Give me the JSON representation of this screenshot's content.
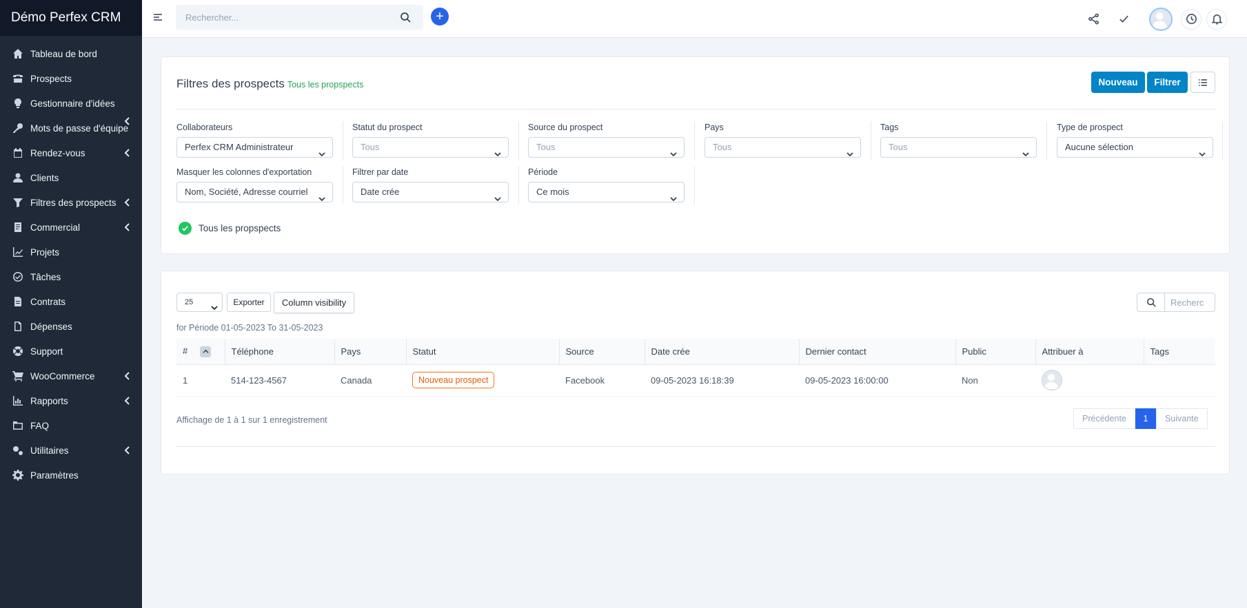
{
  "brand": "Démo Perfex CRM",
  "sidebar": {
    "items": [
      {
        "label": "Tableau de bord",
        "icon": "home-icon"
      },
      {
        "label": "Prospects",
        "icon": "tty-icon"
      },
      {
        "label": "Gestionnaire d'idées",
        "icon": "lightbulb-icon"
      },
      {
        "label": "Mots de passe d'équipe",
        "icon": "key-icon"
      },
      {
        "label": "Rendez-vous",
        "icon": "calendar-icon"
      },
      {
        "label": "Clients",
        "icon": "user-icon"
      },
      {
        "label": "Filtres des prospects",
        "icon": "filter-icon"
      },
      {
        "label": "Commercial",
        "icon": "receipt-icon"
      },
      {
        "label": "Projets",
        "icon": "chart-icon"
      },
      {
        "label": "Tâches",
        "icon": "check-circle-icon"
      },
      {
        "label": "Contrats",
        "icon": "contract-icon"
      },
      {
        "label": "Dépenses",
        "icon": "expense-icon"
      },
      {
        "label": "Support",
        "icon": "lifebuoy-icon"
      },
      {
        "label": "WooCommerce",
        "icon": "cart-icon"
      },
      {
        "label": "Rapports",
        "icon": "bar-chart-icon"
      },
      {
        "label": "FAQ",
        "icon": "folder-icon"
      },
      {
        "label": "Utilitaires",
        "icon": "cogs-icon"
      },
      {
        "label": "Paramètres",
        "icon": "gear-icon"
      }
    ]
  },
  "header": {
    "search_placeholder": "Rechercher..."
  },
  "filters_panel": {
    "title": "Filtres des prospects",
    "subtitle": "Tous les propspects",
    "new_button": "Nouveau",
    "filter_button": "Filtrer",
    "fields": [
      {
        "label": "Collaborateurs",
        "value": "Perfex CRM Administrateur"
      },
      {
        "label": "Statut du prospect",
        "value": "Tous"
      },
      {
        "label": "Source du prospect",
        "value": "Tous"
      },
      {
        "label": "Pays",
        "value": "Tous"
      },
      {
        "label": "Tags",
        "value": "Tous"
      },
      {
        "label": "Type de prospect",
        "value": "Aucune sélection"
      },
      {
        "label": "Masquer les colonnes d'exportation",
        "value": "Nom, Société, Adresse courriel"
      },
      {
        "label": "Filtrer par date",
        "value": "Date crée"
      },
      {
        "label": "Période",
        "value": "Ce mois"
      }
    ],
    "saved_filter": "Tous les propspects"
  },
  "table_panel": {
    "page_length": "25",
    "export_button": "Exporter",
    "column_visibility_button": "Column visibility",
    "search_placeholder": "Recherc",
    "period_text": "for Période 01-05-2023 To 31-05-2023",
    "columns": [
      "#",
      "Téléphone",
      "Pays",
      "Statut",
      "Source",
      "Date crée",
      "Dernier contact",
      "Public",
      "Attribuer à",
      "Tags"
    ],
    "rows": [
      {
        "num": "1",
        "phone": "514-123-4567",
        "country": "Canada",
        "status": "Nouveau prospect",
        "source": "Facebook",
        "created": "09-05-2023 16:18:39",
        "last_contact": "09-05-2023 16:00:00",
        "public": "Non",
        "tags": ""
      }
    ],
    "info": "Affichage de 1 à 1 sur 1 enregistrement",
    "pager": {
      "prev": "Précédente",
      "current": "1",
      "next": "Suivante"
    }
  },
  "colors": {
    "sidebar": "#1f2937",
    "primary": "#0284c7",
    "accent": "#2563eb",
    "success": "#22c55e",
    "badge": "#f97316"
  }
}
